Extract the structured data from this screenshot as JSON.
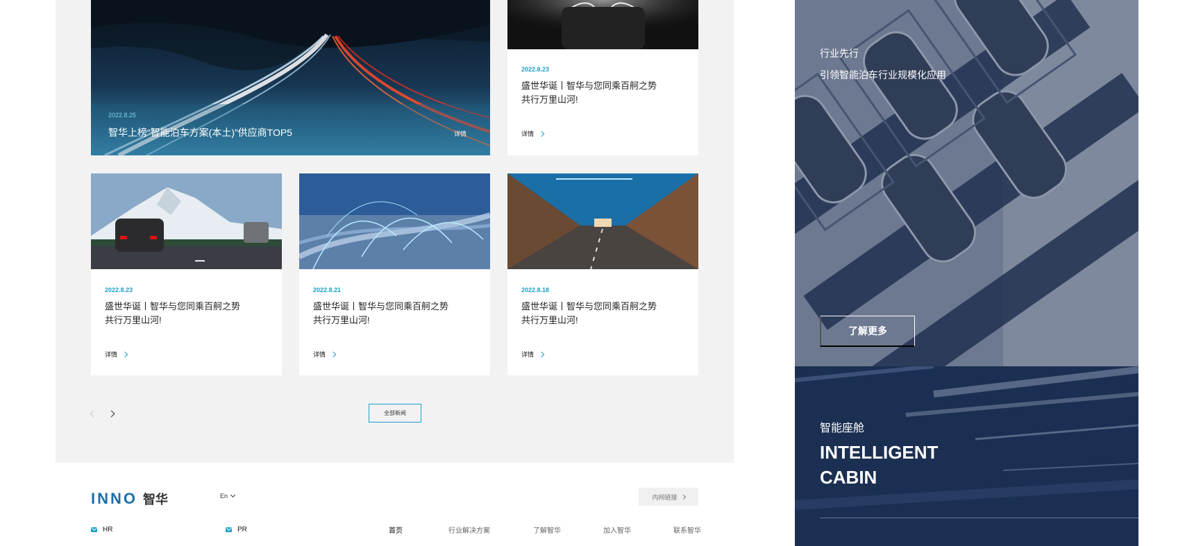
{
  "hero_news": {
    "date": "2022.8.25",
    "title": "智华上榜“智能泊车方案(本土)”供应商TOP5",
    "detail": "详情"
  },
  "news_cards": [
    {
      "date": "2022.8.23",
      "title_line1": "盛世华诞丨智华与您同乘百舸之势",
      "title_line2": "共行万里山河!",
      "detail": "详情"
    },
    {
      "date": "2022.8.23",
      "title_line1": "盛世华诞丨智华与您同乘百舸之势",
      "title_line2": "共行万里山河!",
      "detail": "详情"
    },
    {
      "date": "2022.8.21",
      "title_line1": "盛世华诞丨智华与您同乘百舸之势",
      "title_line2": "共行万里山河!",
      "detail": "详情"
    },
    {
      "date": "2022.8.18",
      "title_line1": "盛世华诞丨智华与您同乘百舸之势",
      "title_line2": "共行万里山河!",
      "detail": "详情"
    }
  ],
  "all_news_button": "全部新闻",
  "footer": {
    "logo_latin": "INNO",
    "logo_cn": "智华",
    "language": "En",
    "intranet": "内网链接",
    "contacts": [
      {
        "label": "HR"
      },
      {
        "label": "PR"
      }
    ],
    "nav": [
      "首页",
      "行业解决方案",
      "了解智华",
      "加入智华",
      "联系智华"
    ]
  },
  "right_top": {
    "tag": "行业先行",
    "subtitle": "引领智能泊车行业规模化应用",
    "button": "了解更多"
  },
  "right_bottom": {
    "tag": "智能座舱",
    "title_line1": "INTELLIGENT",
    "title_line2": "CABIN"
  },
  "colors": {
    "accent": "#1aa0c8",
    "panel_bg": "#f2f2f2",
    "navy": "#1b2f52"
  }
}
